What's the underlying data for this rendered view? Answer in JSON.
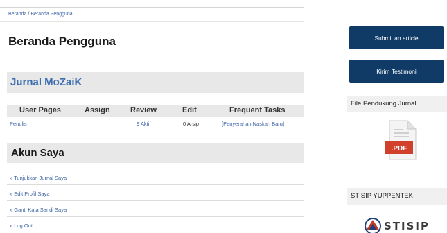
{
  "breadcrumb": {
    "home": "Beranda",
    "separator": "/",
    "current": "Beranda Pengguna"
  },
  "page_title": "Beranda Pengguna",
  "journal": {
    "title": "Jurnal MoZaiK"
  },
  "table": {
    "headers": [
      "User Pages",
      "Assign",
      "Review",
      "Edit",
      "Frequent Tasks"
    ],
    "rows": [
      {
        "role": "Penulis",
        "assign": "",
        "review": "9 Aktif",
        "edit": "0 Arsip",
        "task": "[Penyerahan Naskah Baru]"
      }
    ]
  },
  "account": {
    "title": "Akun Saya",
    "links": [
      "» Tunjukkan Jurnal Saya",
      "» Edit Profil Saya",
      "» Ganti Kata Sandi Saya",
      "» Log Out"
    ]
  },
  "sidebar": {
    "submit_button": "Submit an article",
    "testimoni_button": "Kirim Testimoni",
    "file_heading": "File Pendukung Jurnal",
    "pdf_label": ".PDF",
    "institution_heading": "STISIP YUPPENTEK",
    "logo_text": "STISIP"
  },
  "colors": {
    "link": "#3d62a3",
    "journal_title": "#3d6eb0",
    "button_bg": "#0f3b66",
    "bar_bg": "#e8e8e8",
    "pdf_red": "#d0402a"
  }
}
